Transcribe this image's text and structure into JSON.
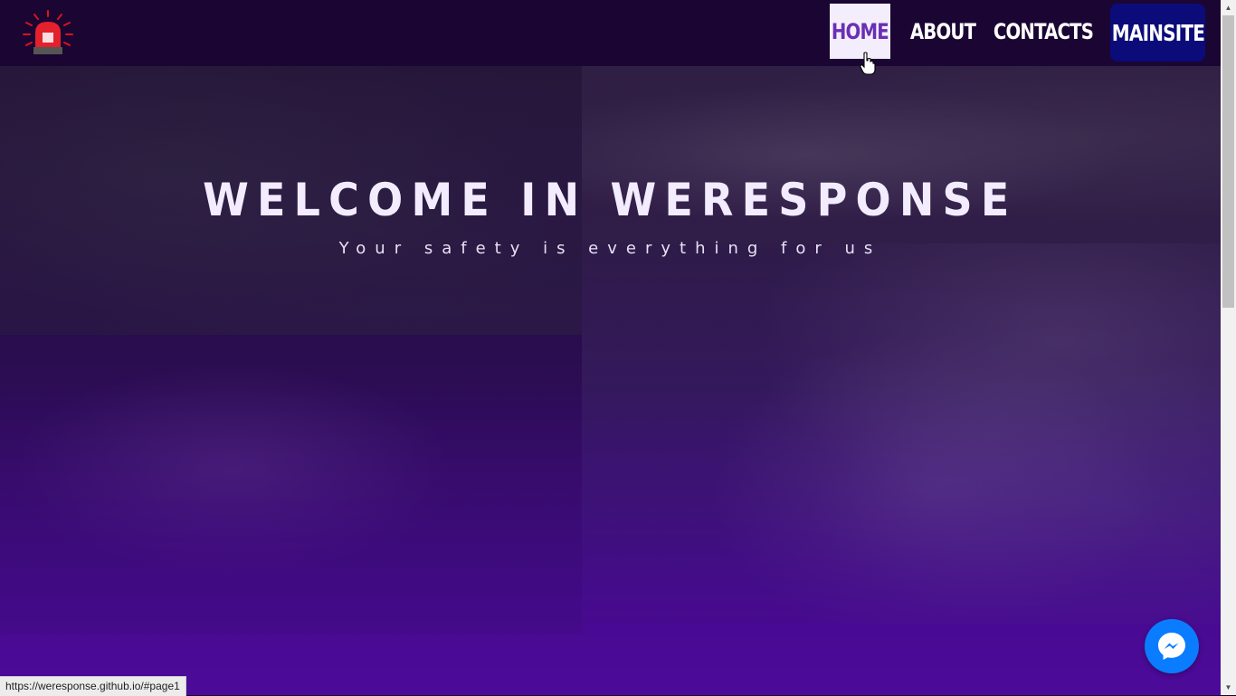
{
  "navbar": {
    "logo_icon": "siren-icon",
    "items": [
      {
        "label": "HOME",
        "active": true
      },
      {
        "label": "ABOUT"
      },
      {
        "label": "CONTACTS"
      }
    ],
    "mainsite_label": "MAINSITE"
  },
  "hero": {
    "title": "WELCOME IN WERESPONSE",
    "subtitle": "Your safety is everything for us"
  },
  "status_bar": {
    "url": "https://weresponse.github.io/#page1"
  },
  "widgets": {
    "chat_icon": "messenger-icon"
  },
  "colors": {
    "nav_bg": "#1b0533",
    "active_nav_bg": "#f4eefc",
    "active_nav_text": "#6a2fb4",
    "mainsite_bg": "#0b0c7a",
    "hero_gradient_bottom": "#4c0a99",
    "messenger_blue": "#0a7cff"
  }
}
